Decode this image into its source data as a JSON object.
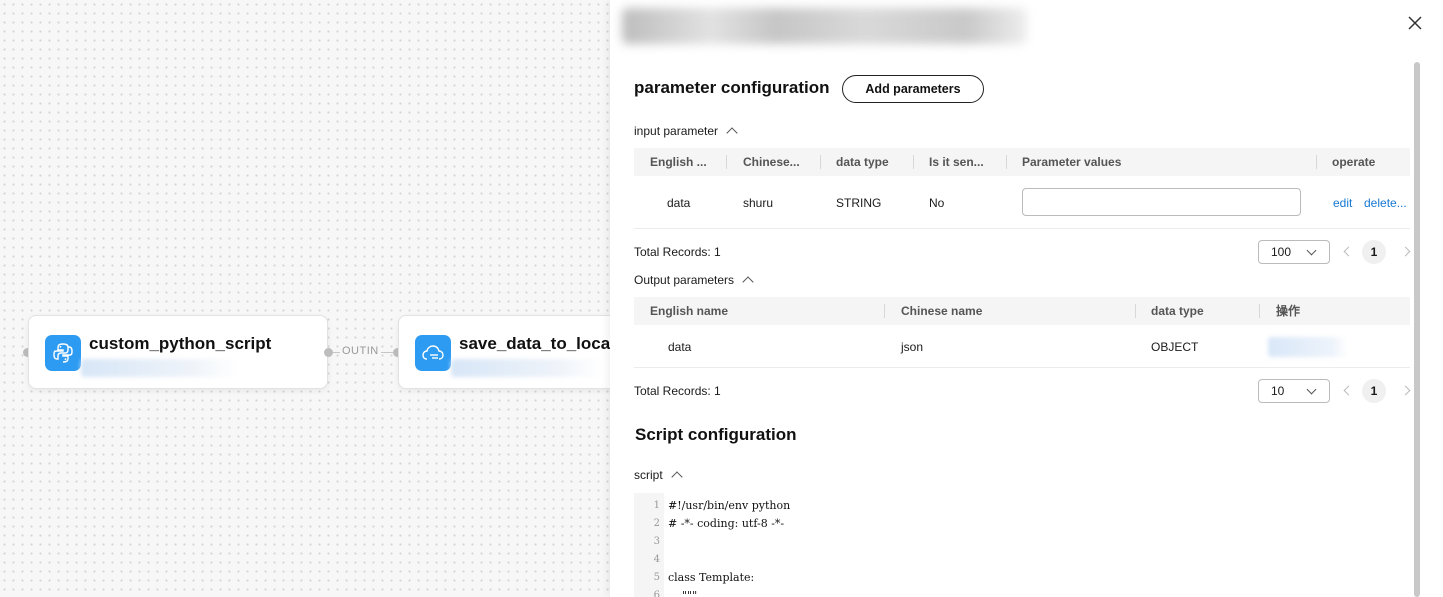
{
  "canvas": {
    "node1": {
      "title": "custom_python_script",
      "icon": "python-icon"
    },
    "node2": {
      "title": "save_data_to_local_",
      "icon": "cloud-upload-icon"
    },
    "edge_label": "OUTIN"
  },
  "panel": {
    "param_config_title": "parameter configuration",
    "add_button": "Add parameters",
    "input_section": {
      "label": "input parameter",
      "headers": [
        "English ...",
        "Chinese...",
        "data type",
        "Is it sen...",
        "Parameter values",
        "operate"
      ],
      "rows": [
        {
          "english": "data",
          "chinese": "shuru",
          "type": "STRING",
          "sensitive": "No",
          "value": "",
          "edit": "edit",
          "delete": "delete..."
        }
      ],
      "total": "Total Records: 1",
      "page_size": "100",
      "page": "1"
    },
    "output_section": {
      "label": "Output parameters",
      "headers": [
        "English name",
        "Chinese name",
        "data type",
        "操作"
      ],
      "rows": [
        {
          "english": "data",
          "chinese": "json",
          "type": "OBJECT"
        }
      ],
      "total": "Total Records: 1",
      "page_size": "10",
      "page": "1"
    },
    "script_config_title": "Script configuration",
    "script_label": "script",
    "code_lines": [
      {
        "n": "1",
        "t": "#!/usr/bin/env python"
      },
      {
        "n": "2",
        "t": "# -*- coding: utf-8 -*-"
      },
      {
        "n": "3",
        "t": ""
      },
      {
        "n": "4",
        "t": ""
      },
      {
        "n": "5",
        "t": "class Template:"
      },
      {
        "n": "6",
        "t": "    \"\"\""
      }
    ]
  },
  "colors": {
    "accent": "#2e9bf2",
    "link": "#1677d2"
  }
}
